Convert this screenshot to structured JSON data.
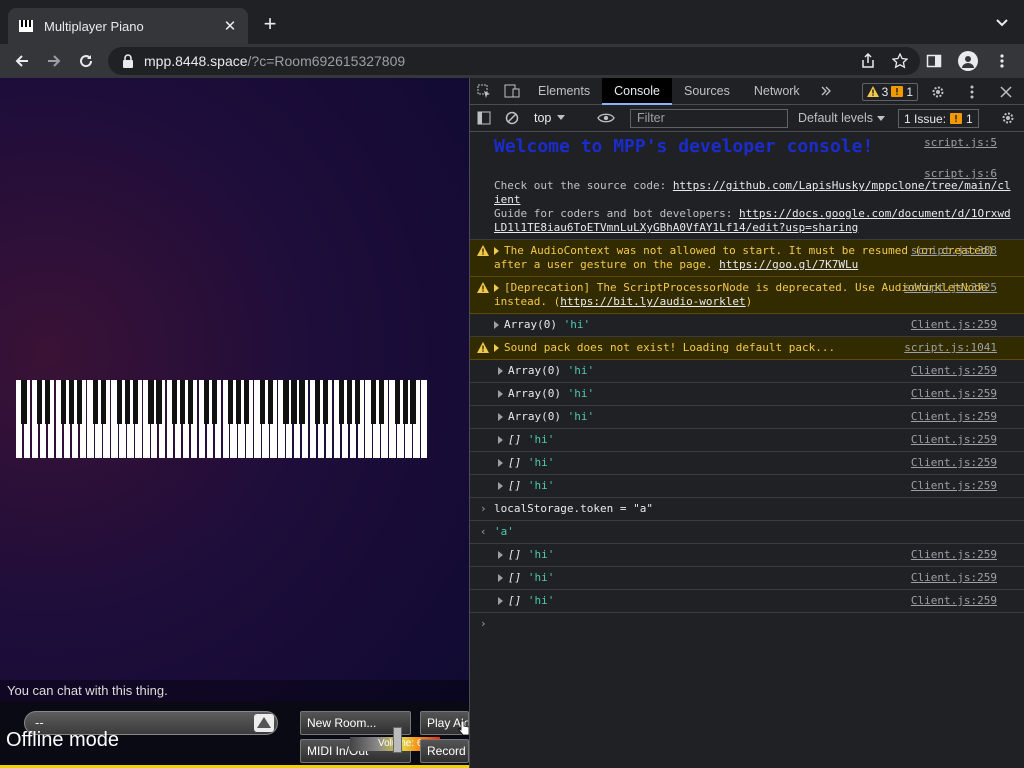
{
  "browser": {
    "tab_title": "Multiplayer Piano",
    "url_host": "mpp.8448.space",
    "url_rest": "/?c=Room692615327809"
  },
  "page": {
    "chat_message": "You can chat with this thing.",
    "room_select_value": "--",
    "offline_text": "Offline mode",
    "buttons": {
      "new_room": "New Room...",
      "play_alone": "Play Alo",
      "midi": "MIDI In/Out",
      "record": "Record M"
    },
    "volume_label": "Volume: 60%",
    "volume_level": 0.6
  },
  "devtools": {
    "tabs": [
      "Elements",
      "Console",
      "Sources",
      "Network"
    ],
    "active_tab": "Console",
    "warnings_count": "3",
    "issues_count": "1",
    "context": "top",
    "filter_placeholder": "Filter",
    "levels": "Default levels",
    "issue_label": "1 Issue:",
    "issue_count_badge": "1",
    "console": {
      "welcome": "Welcome to MPP's developer console!",
      "welcome_src": "script.js:5",
      "info_src": "script.js:6",
      "info_line1_label": "Check out the source code: ",
      "info_line1_link": "https://github.com/LapisHusky/mppclone/tree/main/client",
      "info_line2_label": "Guide for coders and bot developers: ",
      "info_line2_link": "https://docs.google.com/document/d/1OrxwdLD1l1TE8iau6ToETVmnLuLXyGBhA0VfAY1Lf14/edit?usp=sharing",
      "warn1_text": "The AudioContext was not allowed to start. It must be resumed (or created) after a user gesture on the page. ",
      "warn1_link": "https://goo.gl/7K7WLu",
      "warn1_src": "script.js:388",
      "warn2_text": "[Deprecation] The ScriptProcessorNode is deprecated. Use AudioWorkletNode instead. (",
      "warn2_link": "https://bit.ly/audio-worklet",
      "warn2_end": ")",
      "warn2_src": "script.js:3725",
      "warn3_text": "Sound pack does not exist! Loading default pack...",
      "warn3_src": "script.js:1041",
      "array_label": "Array(0)",
      "empty_array": "[]",
      "hi": "'hi'",
      "client_src": "Client.js:259",
      "input_cmd": "localStorage.token = \"a\"",
      "result": "'a'"
    }
  }
}
